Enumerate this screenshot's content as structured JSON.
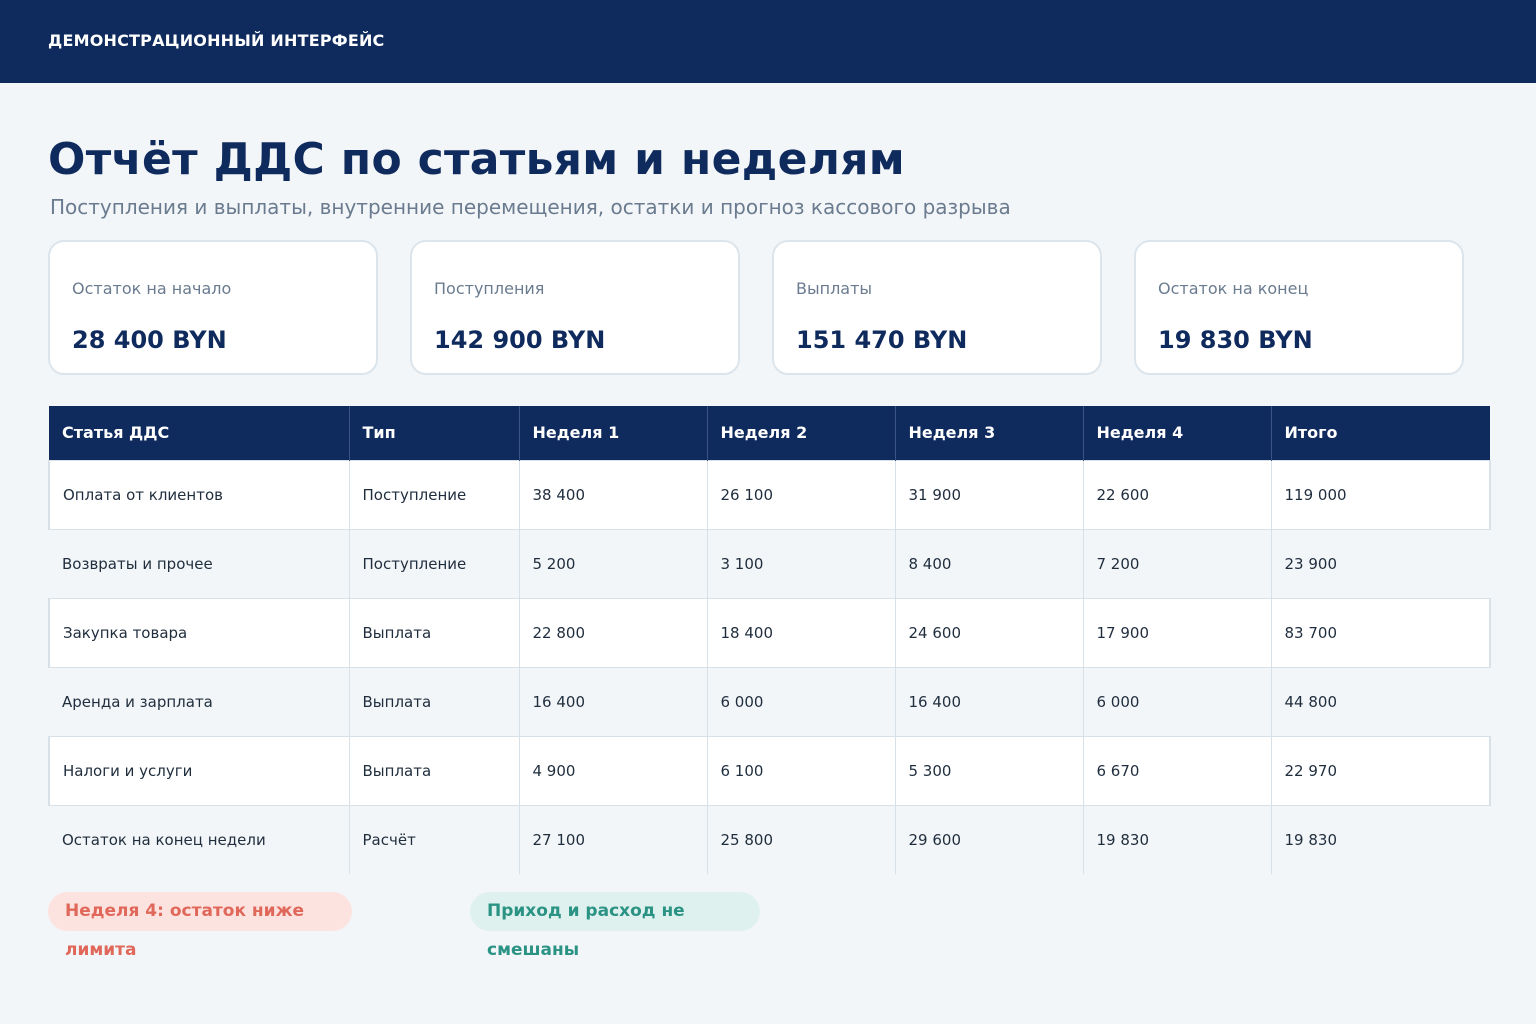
{
  "header": {
    "app_title": "ДЕМОНСТРАЦИОННЫЙ ИНТЕРФЕЙС"
  },
  "page": {
    "title": "Отчёт ДДС по статьям и неделям",
    "subtitle": "Поступления и выплаты, внутренние перемещения, остатки и прогноз кассового разрыва"
  },
  "cards": [
    {
      "label": "Остаток на начало",
      "value": "28 400 BYN"
    },
    {
      "label": "Поступления",
      "value": "142 900 BYN"
    },
    {
      "label": "Выплаты",
      "value": "151 470 BYN"
    },
    {
      "label": "Остаток на конец",
      "value": "19 830 BYN"
    }
  ],
  "table": {
    "columns": [
      "Статья ДДС",
      "Тип",
      "Неделя 1",
      "Неделя 2",
      "Неделя 3",
      "Неделя 4",
      "Итого"
    ],
    "rows": [
      [
        "Оплата от клиентов",
        "Поступление",
        "38 400",
        "26 100",
        "31 900",
        "22 600",
        "119 000"
      ],
      [
        "Возвраты и прочее",
        "Поступление",
        "5 200",
        "3 100",
        "8 400",
        "7 200",
        "23 900"
      ],
      [
        "Закупка товара",
        "Выплата",
        "22 800",
        "18 400",
        "24 600",
        "17 900",
        "83 700"
      ],
      [
        "Аренда и зарплата",
        "Выплата",
        "16 400",
        "6 000",
        "16 400",
        "6 000",
        "44 800"
      ],
      [
        "Налоги и услуги",
        "Выплата",
        "4 900",
        "6 100",
        "5 300",
        "6 670",
        "22 970"
      ],
      [
        "Остаток на конец недели",
        "Расчёт",
        "27 100",
        "25 800",
        "29 600",
        "19 830",
        "19 830"
      ]
    ]
  },
  "badges": {
    "warning": "Неделя 4: остаток ниже лимита",
    "ok": "Приход и расход не смешаны"
  },
  "colors": {
    "header_bg": "#0f2a5c",
    "page_bg": "#f3f6f8",
    "warning_text": "#e0685a",
    "warning_bg": "#fde3e0",
    "ok_text": "#2a9384",
    "ok_bg": "#dff1ee"
  }
}
